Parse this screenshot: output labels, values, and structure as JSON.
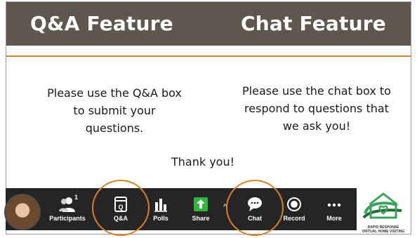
{
  "header": {
    "left_title": "Q&A Feature",
    "right_title": "Chat Feature"
  },
  "body": {
    "left_text": "Please use the Q&A box\nto submit your\nquestions.",
    "right_text": "Please use the chat box to\nrespond to questions that\nwe ask you!",
    "thanks": "Thank you!"
  },
  "toolbar": {
    "participants": {
      "label": "Participants",
      "count": "1",
      "icon": "participants-icon"
    },
    "qa": {
      "label": "Q&A",
      "icon": "qa-icon",
      "glyph": "Q"
    },
    "polls": {
      "label": "Polls",
      "icon": "polls-icon"
    },
    "share": {
      "label": "Share",
      "icon": "share-icon"
    },
    "chat": {
      "label": "Chat",
      "icon": "chat-icon"
    },
    "record": {
      "label": "Record",
      "icon": "record-icon"
    },
    "more": {
      "label": "More",
      "icon": "more-icon"
    }
  },
  "logo": {
    "line1": "RAPID RESPONSE",
    "line2": "VIRTUAL HOME VISITING"
  },
  "colors": {
    "header_bg": "#5f564e",
    "accent": "#d9812a",
    "toolbar_bg": "#252525",
    "share_green": "#2db83d",
    "logo_green": "#3aa35a"
  }
}
